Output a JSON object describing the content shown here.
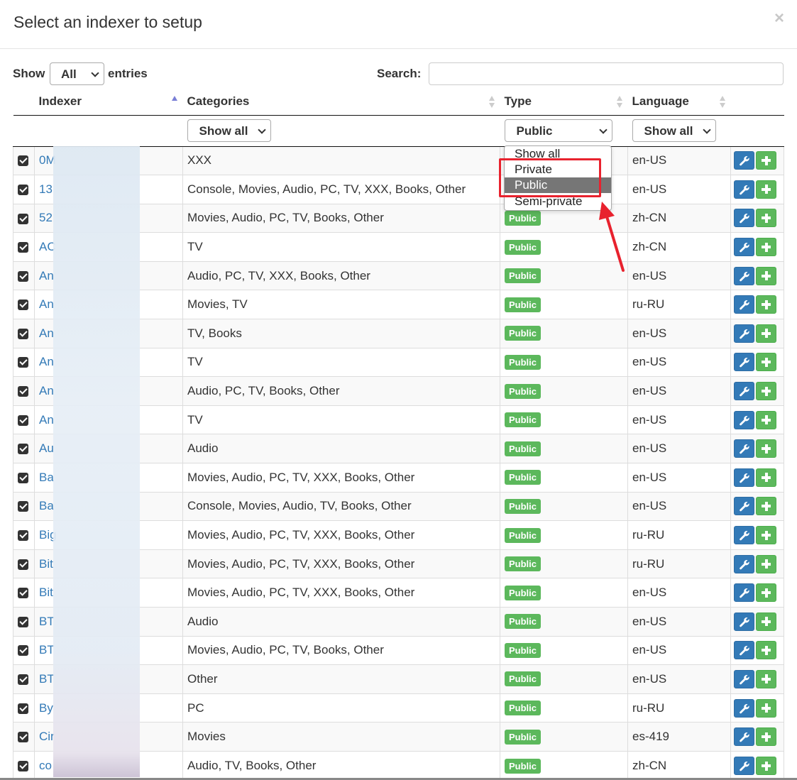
{
  "modal": {
    "title": "Select an indexer to setup",
    "close_label": "×"
  },
  "controls": {
    "show_label": "Show",
    "length_value": "All",
    "entries_label": "entries",
    "search_label": "Search:",
    "search_value": ""
  },
  "columns": {
    "indexer": "Indexer",
    "categories": "Categories",
    "type": "Type",
    "language": "Language"
  },
  "filters": {
    "categories": "Show all",
    "type": "Public",
    "language": "Show all"
  },
  "type_dropdown": {
    "options": [
      "Show all",
      "Private",
      "Public",
      "Semi-private"
    ],
    "selected": "Public"
  },
  "rows": [
    {
      "name": "0M",
      "categories": "XXX",
      "type": "",
      "language": "en-US"
    },
    {
      "name": "13",
      "categories": "Console, Movies, Audio, PC, TV, XXX, Books, Other",
      "type": "",
      "language": "en-US"
    },
    {
      "name": "52",
      "categories": "Movies, Audio, PC, TV, Books, Other",
      "type": "Public",
      "language": "zh-CN"
    },
    {
      "name": "AC",
      "categories": "TV",
      "type": "Public",
      "language": "zh-CN"
    },
    {
      "name": "An",
      "categories": "Audio, PC, TV, XXX, Books, Other",
      "type": "Public",
      "language": "en-US"
    },
    {
      "name": "An",
      "categories": "Movies, TV",
      "type": "Public",
      "language": "ru-RU"
    },
    {
      "name": "An",
      "categories": "TV, Books",
      "type": "Public",
      "language": "en-US"
    },
    {
      "name": "An",
      "categories": "TV",
      "type": "Public",
      "language": "en-US"
    },
    {
      "name": "An",
      "categories": "Audio, PC, TV, Books, Other",
      "type": "Public",
      "language": "en-US"
    },
    {
      "name": "An",
      "categories": "TV",
      "type": "Public",
      "language": "en-US"
    },
    {
      "name": "Au",
      "categories": "Audio",
      "type": "Public",
      "language": "en-US"
    },
    {
      "name": "Ba",
      "categories": "Movies, Audio, PC, TV, XXX, Books, Other",
      "type": "Public",
      "language": "en-US"
    },
    {
      "name": "Ba",
      "categories": "Console, Movies, Audio, TV, Books, Other",
      "type": "Public",
      "language": "en-US"
    },
    {
      "name": "Big",
      "categories": "Movies, Audio, PC, TV, XXX, Books, Other",
      "type": "Public",
      "language": "ru-RU"
    },
    {
      "name": "Bit",
      "categories": "Movies, Audio, PC, TV, XXX, Books, Other",
      "type": "Public",
      "language": "ru-RU"
    },
    {
      "name": "Bit",
      "categories": "Movies, Audio, PC, TV, XXX, Books, Other",
      "type": "Public",
      "language": "en-US"
    },
    {
      "name": "BT",
      "categories": "Audio",
      "type": "Public",
      "language": "en-US"
    },
    {
      "name": "BT",
      "categories": "Movies, Audio, PC, TV, Books, Other",
      "type": "Public",
      "language": "en-US"
    },
    {
      "name": "BT",
      "categories": "Other",
      "type": "Public",
      "language": "en-US"
    },
    {
      "name": "By",
      "categories": "PC",
      "type": "Public",
      "language": "ru-RU"
    },
    {
      "name": "Cir",
      "categories": "Movies",
      "type": "Public",
      "language": "es-419"
    },
    {
      "name": "co",
      "categories": "Audio, TV, Books, Other",
      "type": "Public",
      "language": "zh-CN"
    }
  ],
  "colors": {
    "link": "#337ab7",
    "badge": "#5cb85c",
    "wrench_button": "#337ab7",
    "add_button": "#5cb85c",
    "highlight": "#e8222e"
  }
}
